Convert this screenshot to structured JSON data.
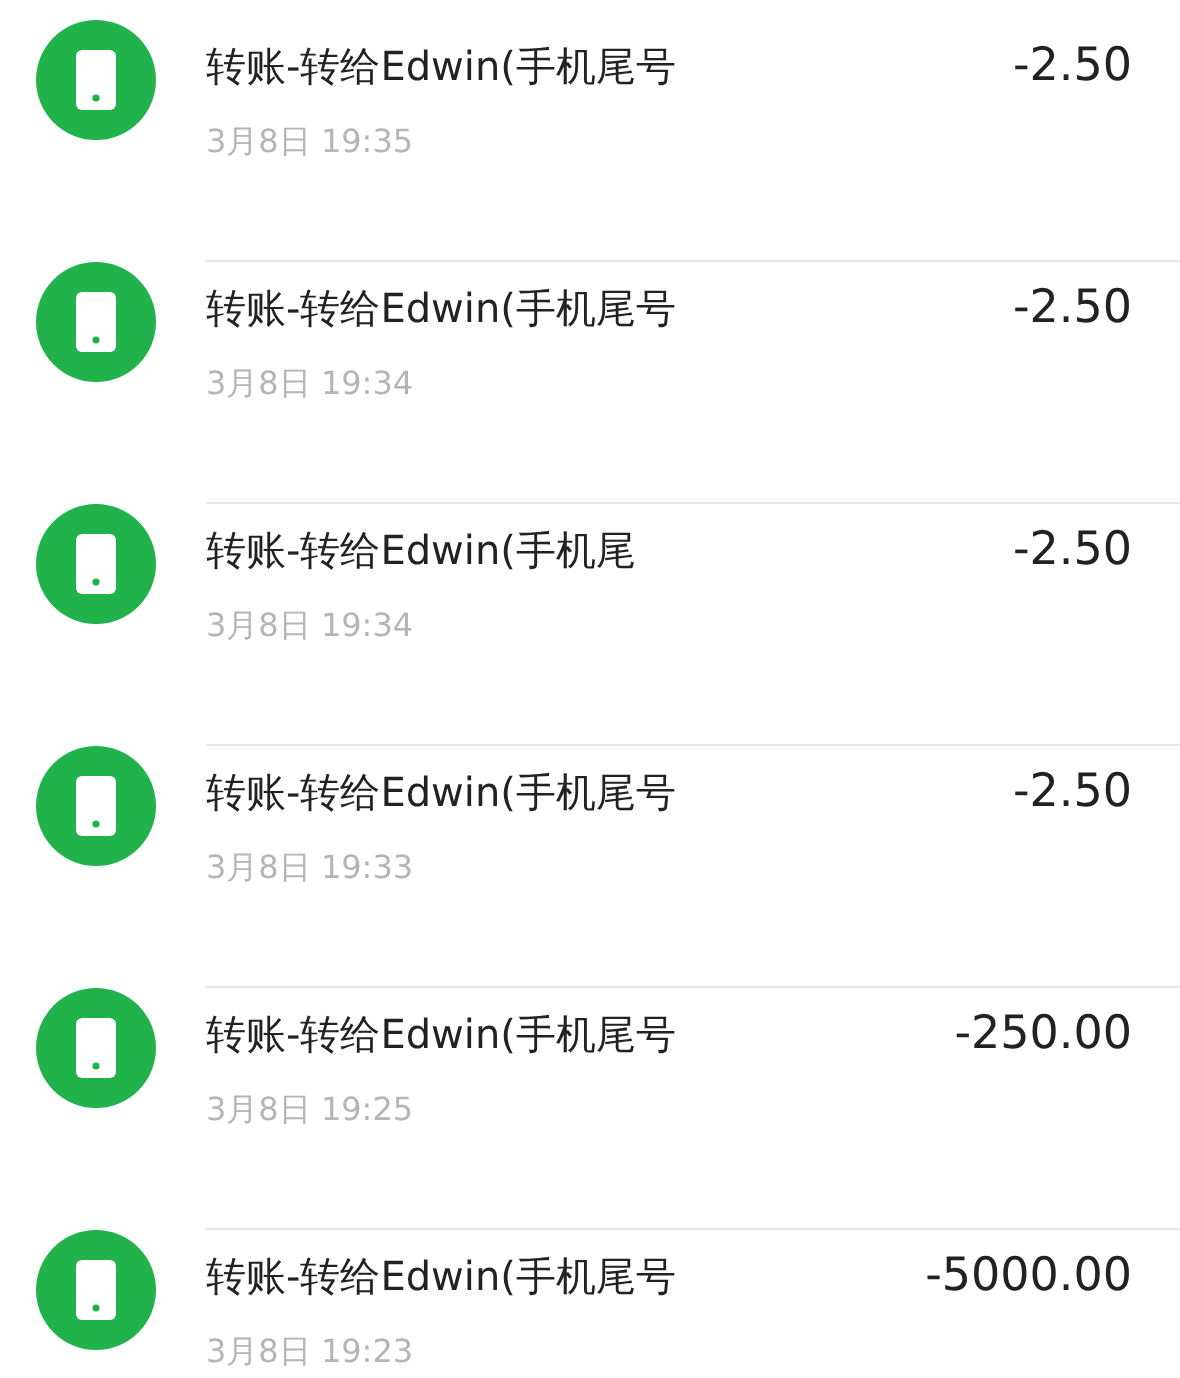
{
  "transactions": [
    {
      "title": "转账-转给Edwin(手机尾号",
      "time": "3月8日 19:35",
      "amount": "-2.50"
    },
    {
      "title": "转账-转给Edwin(手机尾号",
      "time": "3月8日 19:34",
      "amount": "-2.50"
    },
    {
      "title": "转账-转给Edwin(手机尾",
      "time": "3月8日 19:34",
      "amount": "-2.50"
    },
    {
      "title": "转账-转给Edwin(手机尾号",
      "time": "3月8日 19:33",
      "amount": "-2.50"
    },
    {
      "title": "转账-转给Edwin(手机尾号",
      "time": "3月8日 19:25",
      "amount": "-250.00"
    },
    {
      "title": "转账-转给Edwin(手机尾号",
      "time": "3月8日 19:23",
      "amount": "-5000.00"
    }
  ]
}
